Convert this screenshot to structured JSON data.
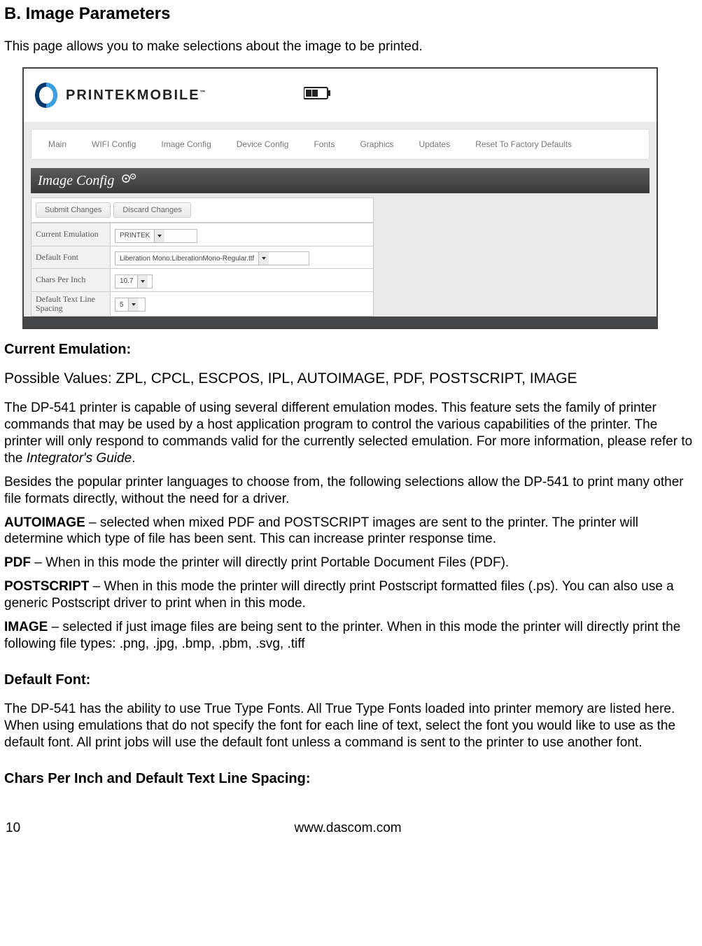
{
  "heading": "B. Image Parameters",
  "intro": "This page allows you to make selections about the image to be printed.",
  "screenshot": {
    "logo_text": "PRINTEKMOBILE",
    "menu_items": [
      "Main",
      "WIFI Config",
      "Image Config",
      "Device Config",
      "Fonts",
      "Graphics",
      "Updates",
      "Reset To Factory Defaults"
    ],
    "panel_title": "Image Config",
    "submit_label": "Submit Changes",
    "discard_label": "Discard Changes",
    "rows": {
      "current_emulation": {
        "label": "Current Emulation",
        "value": "PRINTEK"
      },
      "default_font": {
        "label": "Default Font",
        "value": "Liberation Mono:LiberationMono-Regular.ttf"
      },
      "chars_per_inch": {
        "label": "Chars Per Inch",
        "value": "10.7"
      },
      "line_spacing": {
        "label": "Default Text Line Spacing",
        "value": "5"
      }
    }
  },
  "sections": {
    "current_emulation": {
      "title": "Current Emulation:",
      "possible_values": "Possible Values: ZPL, CPCL, ESCPOS, IPL, AUTOIMAGE, PDF, POSTSCRIPT, IMAGE",
      "p1a": "The DP-541 printer is capable of using several different emulation modes.  This feature sets the family of printer commands that may be used by a host application program to control the various capabilities of the printer. The printer will only respond to commands valid for the currently selected emulation. For more information, please refer to the ",
      "p1b": "Integrator's Guide",
      "p1c": ".",
      "p2": "Besides the popular printer languages to choose from, the following selections allow the DP-541 to print many other file formats directly, without the need for a driver.",
      "autoimage_label": "AUTOIMAGE",
      "autoimage_text": " – selected when mixed PDF and POSTSCRIPT images are sent to the printer.  The printer will determine which type of file has been sent.  This can increase printer response time.",
      "pdf_label": "PDF",
      "pdf_text": " – When in this mode the printer will directly print Portable Document Files (PDF).",
      "postscript_label": "POSTSCRIPT",
      "postscript_text": " – When in this mode the printer will directly print Postscript formatted files (.ps).  You can also use a generic Postscript driver to print when in this mode.",
      "image_label": "IMAGE",
      "image_text": " – selected if just image files are being sent to the printer.  When in this mode the printer will directly print the following file types:  .png, .jpg, .bmp, .pbm, .svg, .tiff"
    },
    "default_font": {
      "title": "Default Font:",
      "text": "The DP-541 has the ability to use True Type Fonts.  All True Type Fonts loaded into printer memory are listed here.  When using emulations that do not specify the font for each line of text, select the font you would like to use as the default font.  All print jobs will use the default font unless a command is sent to the printer to use another font."
    },
    "cpi": {
      "title": "Chars Per Inch and Default Text Line Spacing:"
    }
  },
  "footer": {
    "page_number": "10",
    "url": "www.dascom.com"
  }
}
